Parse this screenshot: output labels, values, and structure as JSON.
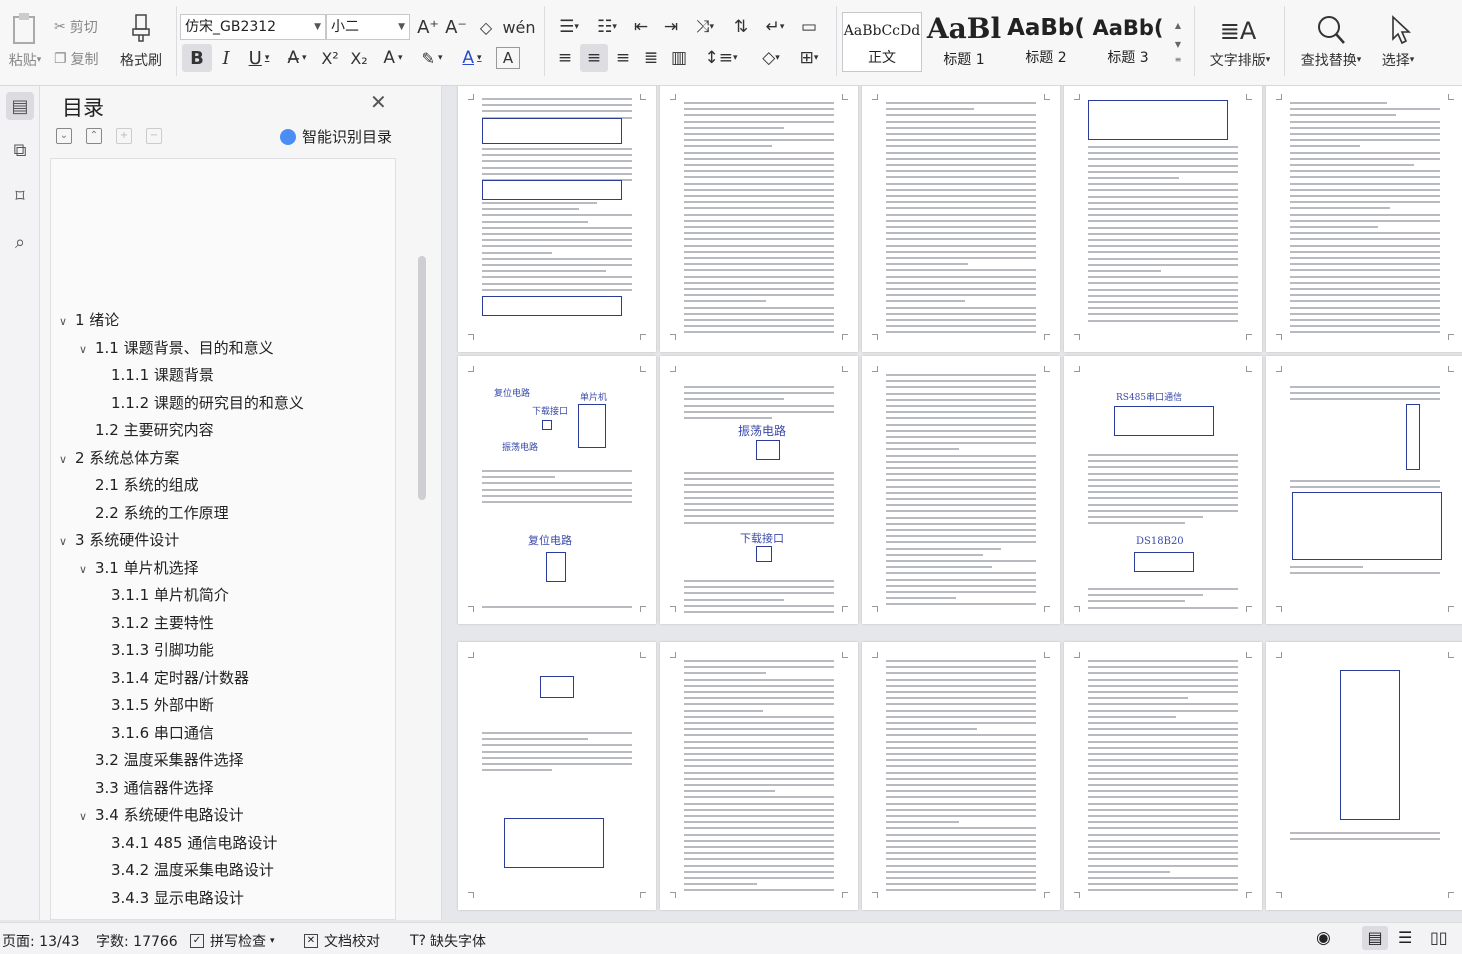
{
  "ribbon": {
    "paste": "粘贴",
    "cut": "剪切",
    "copy": "复制",
    "format_painter": "格式刷",
    "font_name": "仿宋_GB2312",
    "font_size": "小二",
    "bold": "B",
    "italic": "I",
    "underline": "U",
    "styles": [
      {
        "preview": "AaBbCcDd",
        "label": "正文"
      },
      {
        "preview": "AaBl",
        "label": "标题 1"
      },
      {
        "preview": "AaBb(",
        "label": "标题 2"
      },
      {
        "preview": "AaBb(",
        "label": "标题 3"
      }
    ],
    "text_layout": "文字排版",
    "find_replace": "查找替换",
    "select": "选择"
  },
  "toc": {
    "title": "目录",
    "smart_toc": "智能识别目录",
    "items": [
      {
        "text": "1  绪论",
        "level": 1,
        "expanded": true
      },
      {
        "text": "1.1  课题背景、目的和意义",
        "level": 2,
        "expanded": true
      },
      {
        "text": "1.1.1  课题背景",
        "level": 3
      },
      {
        "text": "1.1.2 课题的研究目的和意义",
        "level": 3
      },
      {
        "text": "1.2  主要研究内容",
        "level": 2
      },
      {
        "text": "2  系统总体方案",
        "level": 1,
        "expanded": true
      },
      {
        "text": "2.1 系统的组成",
        "level": 2
      },
      {
        "text": "2.2 系统的工作原理",
        "level": 2
      },
      {
        "text": "3 系统硬件设计",
        "level": 1,
        "expanded": true
      },
      {
        "text": "3.1 单片机选择",
        "level": 2,
        "expanded": true
      },
      {
        "text": "3.1.1 单片机简介",
        "level": 3
      },
      {
        "text": "3.1.2 主要特性",
        "level": 3
      },
      {
        "text": "3.1.3 引脚功能",
        "level": 3
      },
      {
        "text": "3.1.4 定时器/计数器",
        "level": 3
      },
      {
        "text": "3.1.5 外部中断",
        "level": 3
      },
      {
        "text": "3.1.6 串口通信",
        "level": 3
      },
      {
        "text": "3.2 温度采集器件选择",
        "level": 2
      },
      {
        "text": "3.3 通信器件选择",
        "level": 2
      },
      {
        "text": "3.4  系统硬件电路设计",
        "level": 2,
        "expanded": true
      },
      {
        "text": "3.4.1 485 通信电路设计",
        "level": 3
      },
      {
        "text": "3.4.2 温度采集电路设计",
        "level": 3
      },
      {
        "text": "3.4.3 显示电路设计",
        "level": 3
      }
    ]
  },
  "pages": {
    "figure_labels": {
      "reset_circuit": "复位电路",
      "mcu": "单片机",
      "download_port": "下载接口",
      "oscillator": "振荡电路",
      "reset_circuit_2": "复位电路",
      "oscillator_big": "振荡电路",
      "download_port_2": "下载接口",
      "rs485": "RS485串口通信",
      "ds18b20": "DS18B20"
    }
  },
  "status": {
    "page": "页面: 13/43",
    "word_count": "字数: 17766",
    "spell_check": "拼写检查",
    "doc_proof": "文档校对",
    "missing_font": "缺失字体"
  }
}
